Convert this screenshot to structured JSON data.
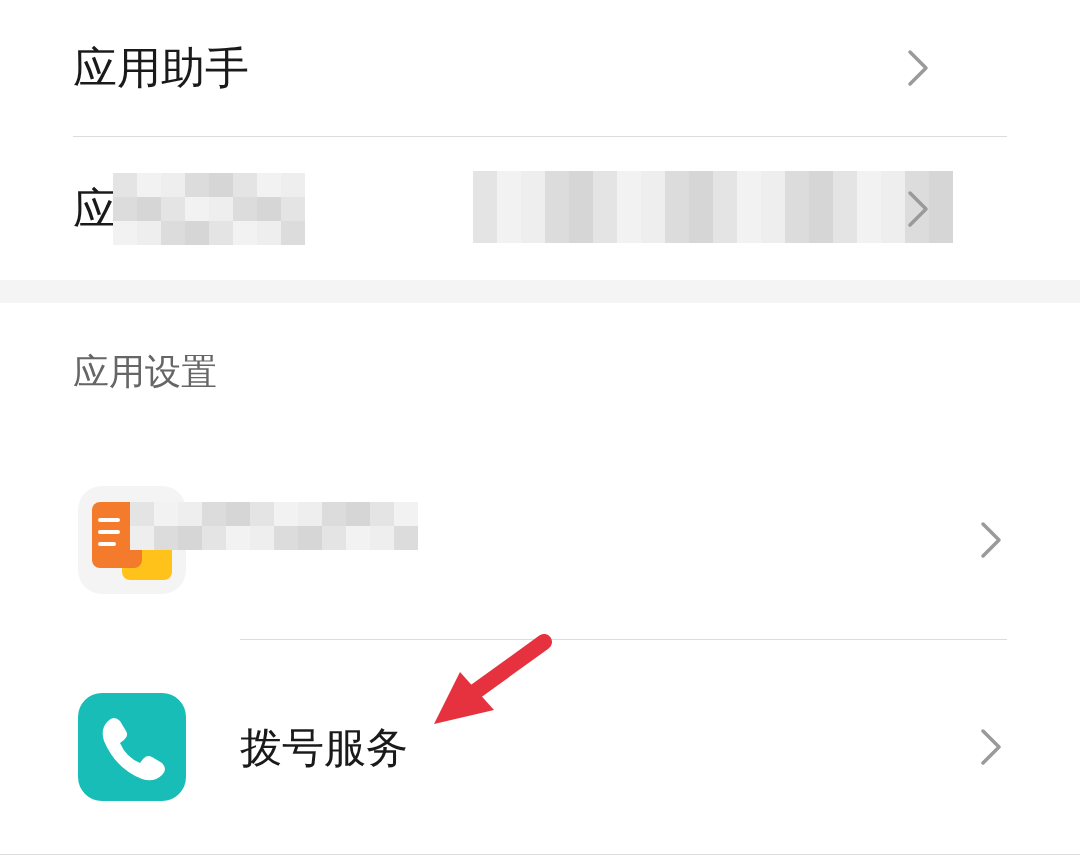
{
  "top_rows": [
    {
      "label": "应用助手",
      "redacted": false
    },
    {
      "label": "应",
      "redacted": true
    }
  ],
  "section": {
    "title": "应用设置",
    "items": [
      {
        "kind": "memo",
        "redacted": true
      },
      {
        "kind": "dialer",
        "label": "拨号服务",
        "redacted": false
      }
    ]
  },
  "annotation": {
    "kind": "arrow"
  }
}
